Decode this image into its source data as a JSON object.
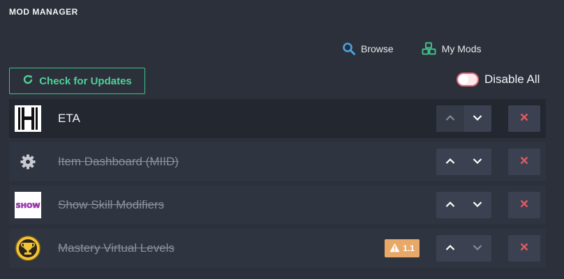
{
  "header": {
    "title": "MOD MANAGER"
  },
  "nav": {
    "browse_label": "Browse",
    "mymods_label": "My Mods"
  },
  "actions": {
    "check_updates_label": "Check for Updates",
    "disable_all_label": "Disable All",
    "disable_all_on": false
  },
  "colors": {
    "accent_green": "#3fc28a",
    "browse_icon": "#4aa3e0",
    "mymods_icon": "#3fbf8a",
    "remove_red": "#e05a62",
    "warning_badge": "#e8a868",
    "background": "#2b303b"
  },
  "mods": [
    {
      "name": "ETA",
      "enabled": true,
      "icon": "eta-logo-icon"
    },
    {
      "name": "Item Dashboard (MIID)",
      "enabled": false,
      "icon": "gear-icon"
    },
    {
      "name": "Show Skill Modifiers",
      "enabled": false,
      "icon": "show-logo-icon",
      "icon_text": "SHOW"
    },
    {
      "name": "Mastery Virtual Levels",
      "enabled": false,
      "icon": "trophy-icon",
      "warning": "1.1"
    }
  ]
}
